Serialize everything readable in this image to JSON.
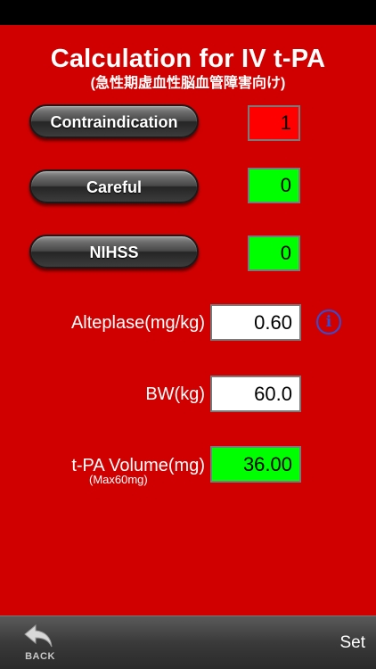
{
  "header": {
    "title": "Calculation for IV t-PA",
    "subtitle": "(急性期虚血性脳血管障害向け)"
  },
  "buttons": {
    "contraindication": {
      "label": "Contraindication",
      "value": "1"
    },
    "careful": {
      "label": "Careful",
      "value": "0"
    },
    "nihss": {
      "label": "NIHSS",
      "value": "0"
    }
  },
  "fields": {
    "alteplase": {
      "label": "Alteplase(mg/kg)",
      "value": "0.60"
    },
    "bw": {
      "label": "BW(kg)",
      "value": "60.0"
    },
    "volume": {
      "label": "t-PA Volume(mg)",
      "sublabel": "(Max60mg)",
      "value": "36.00"
    }
  },
  "icons": {
    "info": "info-icon",
    "back": "back-arrow-icon"
  },
  "toolbar": {
    "back_label": "BACK",
    "set_label": "Set"
  },
  "colors": {
    "background": "#d10000",
    "alert": "#ff0000",
    "ok": "#00ff00",
    "info": "#2f4fd8"
  }
}
